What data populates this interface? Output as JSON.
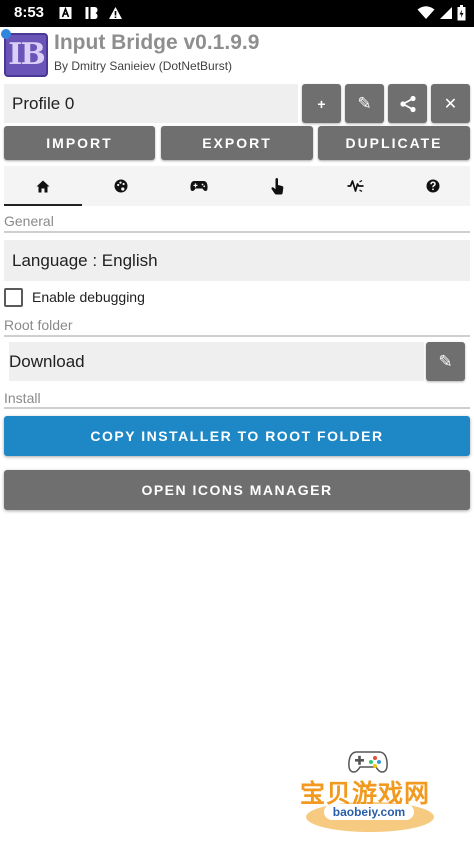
{
  "status_bar": {
    "time": "8:53",
    "left_icons": [
      "a-notification-icon",
      "ib-notification-icon",
      "warning-icon"
    ],
    "right_icons": [
      "wifi-icon",
      "signal-icon",
      "battery-icon"
    ]
  },
  "header": {
    "logo_text": "IB",
    "title": "Input Bridge v0.1.9.9",
    "author": "By Dmitry Sanieiev (DotNetBurst)"
  },
  "profile": {
    "name": "Profile 0",
    "actions": [
      {
        "name": "add-icon",
        "glyph": "+"
      },
      {
        "name": "edit-icon",
        "glyph": "✎"
      },
      {
        "name": "share-icon",
        "glyph": ""
      },
      {
        "name": "close-icon",
        "glyph": "✕"
      }
    ]
  },
  "toolbar": {
    "import_label": "IMPORT",
    "export_label": "EXPORT",
    "duplicate_label": "DUPLICATE"
  },
  "tabs": [
    {
      "icon": "home-icon",
      "selected": true
    },
    {
      "icon": "palette-icon",
      "selected": false
    },
    {
      "icon": "gamepad-icon",
      "selected": false
    },
    {
      "icon": "touch-icon",
      "selected": false
    },
    {
      "icon": "vibration-icon",
      "selected": false
    },
    {
      "icon": "help-icon",
      "selected": false
    }
  ],
  "general": {
    "section_label": "General",
    "language_field": "Language : English",
    "debug_label": "Enable debugging",
    "debug_checked": false
  },
  "root_folder": {
    "section_label": "Root folder",
    "value": "Download"
  },
  "install": {
    "section_label": "Install",
    "copy_installer_label": "COPY INSTALLER TO ROOT FOLDER",
    "open_icons_label": "OPEN ICONS MANAGER"
  },
  "watermark": {
    "text": "宝贝游戏网",
    "url": "baobeiy.com"
  },
  "colors": {
    "primary": "#1e88c7",
    "button_gray": "#6f6f6f",
    "field_bg": "#efefef",
    "title_gray": "#8e8e8e"
  }
}
